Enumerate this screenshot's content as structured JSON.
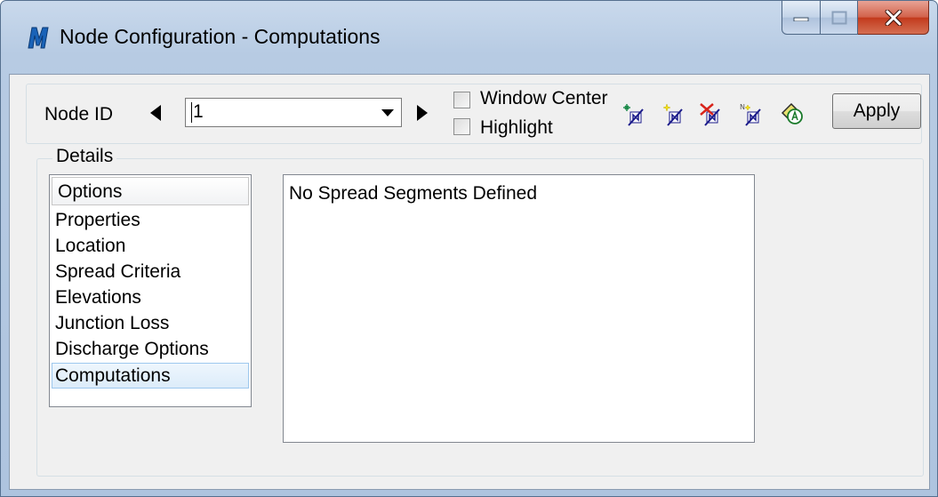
{
  "window": {
    "title": "Node Configuration - Computations",
    "app_icon": "microstation-m-icon"
  },
  "toolbar": {
    "node_id_label": "Node ID",
    "node_id_value": "1",
    "window_center_label": "Window Center",
    "highlight_label": "Highlight",
    "window_center_checked": false,
    "highlight_checked": false,
    "apply_label": "Apply",
    "icons": [
      "add-node-icon",
      "new-node-icon",
      "delete-node-icon",
      "renumber-node-icon",
      "node-properties-icon"
    ]
  },
  "details": {
    "legend": "Details",
    "options_header": "Options",
    "options": [
      "Properties",
      "Location",
      "Spread Criteria",
      "Elevations",
      "Junction Loss",
      "Discharge Options",
      "Computations"
    ],
    "selected_option": "Computations",
    "content_text": "No Spread Segments Defined"
  },
  "colors": {
    "title_bar": "#b9cde5",
    "close_button": "#c7432a",
    "selection": "#dcecfa"
  }
}
